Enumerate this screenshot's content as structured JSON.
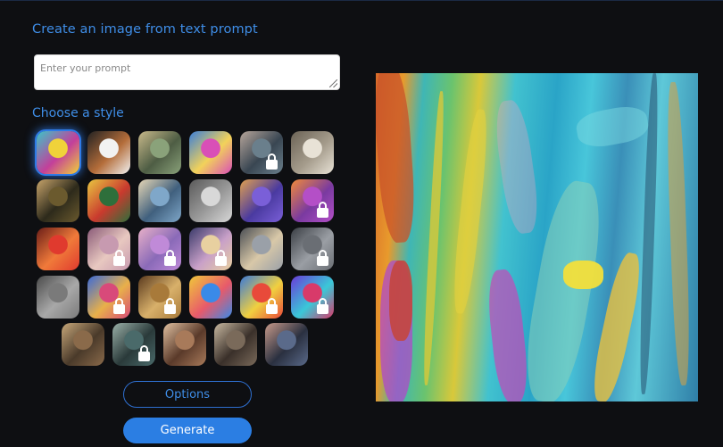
{
  "title": "Create an image from text prompt",
  "prompt": {
    "placeholder": "Enter your prompt",
    "value": ""
  },
  "styles_label": "Choose a style",
  "style_tiles": [
    {
      "name": "abstract-paint",
      "locked": false,
      "selected": true,
      "colors": [
        "#f0d23a",
        "#3cc4c8",
        "#c33f9a"
      ]
    },
    {
      "name": "panda",
      "locked": false,
      "selected": false,
      "colors": [
        "#f2f2f2",
        "#222222",
        "#b46d3a"
      ]
    },
    {
      "name": "landscape-painting",
      "locked": false,
      "selected": false,
      "colors": [
        "#8aa27a",
        "#c8b98a",
        "#4e5d44"
      ]
    },
    {
      "name": "robot",
      "locked": false,
      "selected": false,
      "colors": [
        "#d94fb7",
        "#3b7fd8",
        "#f2d25a"
      ]
    },
    {
      "name": "woman-portrait",
      "locked": true,
      "selected": false,
      "colors": [
        "#6a7f8c",
        "#b6a59a",
        "#394652"
      ]
    },
    {
      "name": "sketch-figures",
      "locked": false,
      "selected": false,
      "colors": [
        "#e8e2d6",
        "#6b6356",
        "#a59c8c"
      ]
    },
    {
      "name": "mona-lisa",
      "locked": false,
      "selected": false,
      "colors": [
        "#6b5a2e",
        "#c7a46a",
        "#2d2a1b"
      ]
    },
    {
      "name": "flowers",
      "locked": false,
      "selected": false,
      "colors": [
        "#2e6f3b",
        "#e8c640",
        "#c93a2e"
      ]
    },
    {
      "name": "dancers",
      "locked": false,
      "selected": false,
      "colors": [
        "#7fa7c9",
        "#e6d7b5",
        "#40607e"
      ]
    },
    {
      "name": "metal-cup",
      "locked": false,
      "selected": false,
      "colors": [
        "#d8d8d8",
        "#5a5a5a",
        "#9a9a9a"
      ]
    },
    {
      "name": "isometric-room",
      "locked": false,
      "selected": false,
      "colors": [
        "#7a5fd8",
        "#e0a050",
        "#4a3aa0"
      ]
    },
    {
      "name": "fox",
      "locked": true,
      "selected": false,
      "colors": [
        "#b44fc7",
        "#f08a3a",
        "#7a3aa0"
      ]
    },
    {
      "name": "neon-face",
      "locked": false,
      "selected": false,
      "colors": [
        "#e03a2e",
        "#6a1e18",
        "#f07a3a"
      ]
    },
    {
      "name": "soft-portrait",
      "locked": true,
      "selected": false,
      "colors": [
        "#c79ab0",
        "#8a5a78",
        "#e8c8c0"
      ]
    },
    {
      "name": "pastel-blur",
      "locked": true,
      "selected": false,
      "colors": [
        "#c08ad8",
        "#e8b0c8",
        "#8a6ab8"
      ]
    },
    {
      "name": "pop-art-marilyn",
      "locked": true,
      "selected": false,
      "colors": [
        "#e8d0a0",
        "#3a3a6a",
        "#c8a0c8"
      ]
    },
    {
      "name": "modern-house",
      "locked": false,
      "selected": false,
      "colors": [
        "#9aa0a8",
        "#4a4e54",
        "#d8c8a8"
      ]
    },
    {
      "name": "misty-scene",
      "locked": true,
      "selected": false,
      "colors": [
        "#6a6e74",
        "#3a3e44",
        "#9a9ea4"
      ]
    },
    {
      "name": "grey-texture",
      "locked": false,
      "selected": false,
      "colors": [
        "#7a7a7a",
        "#4a4a4a",
        "#a8a8a8"
      ]
    },
    {
      "name": "colorful-figure",
      "locked": true,
      "selected": false,
      "colors": [
        "#d84a7a",
        "#3a6ad8",
        "#e8b04a"
      ]
    },
    {
      "name": "golden-abstract",
      "locked": true,
      "selected": false,
      "colors": [
        "#a87a3a",
        "#5a3a1e",
        "#d8b06a"
      ]
    },
    {
      "name": "icon-grid",
      "locked": false,
      "selected": false,
      "colors": [
        "#3a8ae8",
        "#f0c83a",
        "#e85a6a"
      ]
    },
    {
      "name": "vivid-swirl",
      "locked": true,
      "selected": false,
      "colors": [
        "#e84a3a",
        "#3a7ad8",
        "#f0d040"
      ]
    },
    {
      "name": "glitch-art",
      "locked": true,
      "selected": false,
      "colors": [
        "#d83a6a",
        "#6a3ad8",
        "#3ac8d8"
      ]
    },
    {
      "name": "fantasy-creature",
      "locked": false,
      "selected": false,
      "colors": [
        "#8a6a4a",
        "#c8a87a",
        "#4a3a2a"
      ]
    },
    {
      "name": "dark-portrait",
      "locked": true,
      "selected": false,
      "colors": [
        "#4a6a6a",
        "#9ab0a8",
        "#2a3a3a"
      ]
    },
    {
      "name": "classic-portrait",
      "locked": false,
      "selected": false,
      "colors": [
        "#a87a5a",
        "#e0c0a0",
        "#5a3a2a"
      ]
    },
    {
      "name": "steampunk-man",
      "locked": false,
      "selected": false,
      "colors": [
        "#7a6a5a",
        "#c8b8a0",
        "#3a302a"
      ]
    },
    {
      "name": "comic-face",
      "locked": false,
      "selected": false,
      "colors": [
        "#5a6a8a",
        "#c89a8a",
        "#2a3040"
      ]
    }
  ],
  "buttons": {
    "options": "Options",
    "generate": "Generate"
  },
  "accent_color": "#3f8ee8",
  "preview_image": {
    "alt_icon": "generated-artwork"
  }
}
